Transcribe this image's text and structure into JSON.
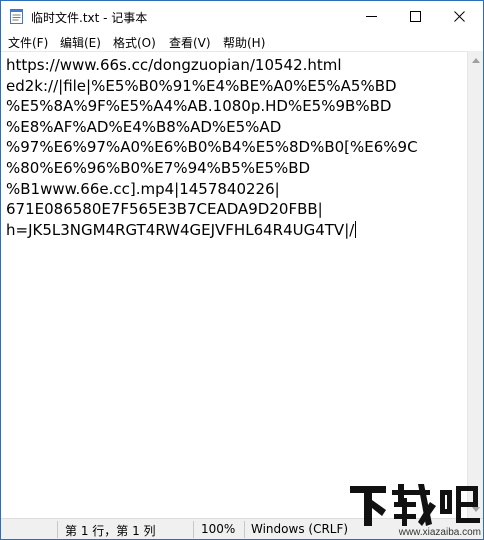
{
  "window": {
    "title": "临时文件.txt - 记事本",
    "app_icon": "notepad-icon"
  },
  "controls": {
    "minimize_icon": "minimize-icon",
    "maximize_icon": "maximize-icon",
    "close_icon": "close-icon"
  },
  "menu": [
    {
      "label": "文件(F)"
    },
    {
      "label": "编辑(E)"
    },
    {
      "label": "格式(O)"
    },
    {
      "label": "查看(V)"
    },
    {
      "label": "帮助(H)"
    }
  ],
  "editor": {
    "lines": [
      "https://www.66s.cc/dongzuopian/10542.html",
      "ed2k://|file|%E5%B0%91%E4%BE%A0%E5%A5%BD",
      "%E5%8A%9F%E5%A4%AB.1080p.HD%E5%9B%BD",
      "%E8%AF%AD%E4%B8%AD%E5%AD",
      "%97%E6%97%A0%E6%B0%B4%E5%8D%B0[%E6%9C",
      "%80%E6%96%B0%E7%94%B5%E5%BD",
      "%B1www.66e.cc].mp4|1457840226|",
      "671E086580E7F565E3B7CEADA9D20FBB|",
      "h=JK5L3NGM4RGT4RW4GEJVFHL64R4UG4TV|/"
    ]
  },
  "statusbar": {
    "position": "第 1 行，第 1 列",
    "zoom": "100%",
    "line_ending": "Windows (CRLF)"
  },
  "watermark": {
    "logo_text": "下载吧",
    "url": "www.xiazaiba.com"
  }
}
